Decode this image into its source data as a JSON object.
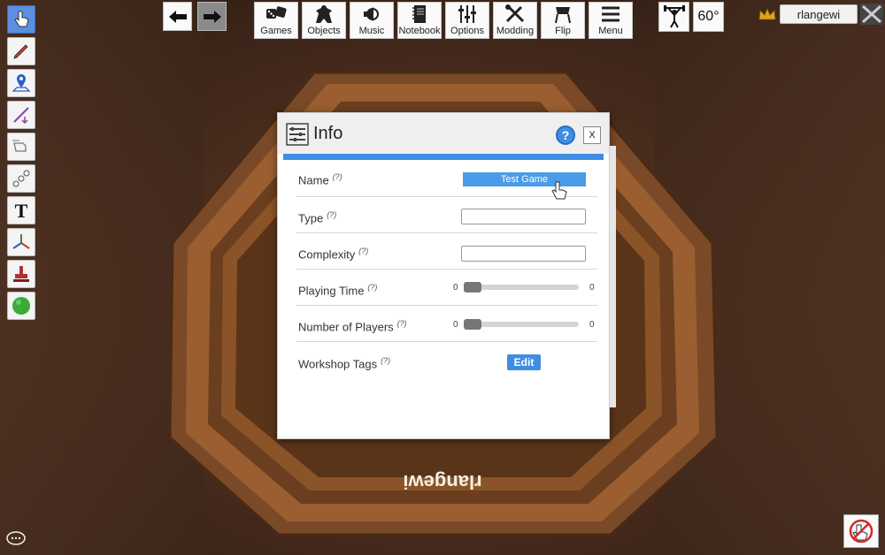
{
  "top_toolbar": {
    "buttons": [
      {
        "label": "Games",
        "icon": "dice-icon"
      },
      {
        "label": "Objects",
        "icon": "meeple-icon"
      },
      {
        "label": "Music",
        "icon": "speaker-icon"
      },
      {
        "label": "Notebook",
        "icon": "notebook-icon"
      },
      {
        "label": "Options",
        "icon": "sliders-icon"
      },
      {
        "label": "Modding",
        "icon": "tools-icon"
      },
      {
        "label": "Flip",
        "icon": "flip-table-icon"
      },
      {
        "label": "Menu",
        "icon": "hamburger-icon"
      }
    ],
    "rotation": "60°"
  },
  "user": {
    "name": "rlangewi"
  },
  "table": {
    "player_label": "rlangewi"
  },
  "dialog": {
    "title": "Info",
    "help_symbol": "?",
    "close_label": "X",
    "question_mark": "(?)",
    "fields": {
      "name": {
        "label": "Name",
        "value": "Test Game"
      },
      "type": {
        "label": "Type",
        "value": ""
      },
      "complexity": {
        "label": "Complexity",
        "value": ""
      },
      "playing_time": {
        "label": "Playing Time",
        "min": "0",
        "max": "0"
      },
      "num_players": {
        "label": "Number of Players",
        "min": "0",
        "max": "0"
      },
      "workshop_tags": {
        "label": "Workshop Tags",
        "button": "Edit"
      }
    }
  },
  "colors": {
    "accent": "#3f8ee4",
    "active_tool": "#5b8fe0"
  }
}
